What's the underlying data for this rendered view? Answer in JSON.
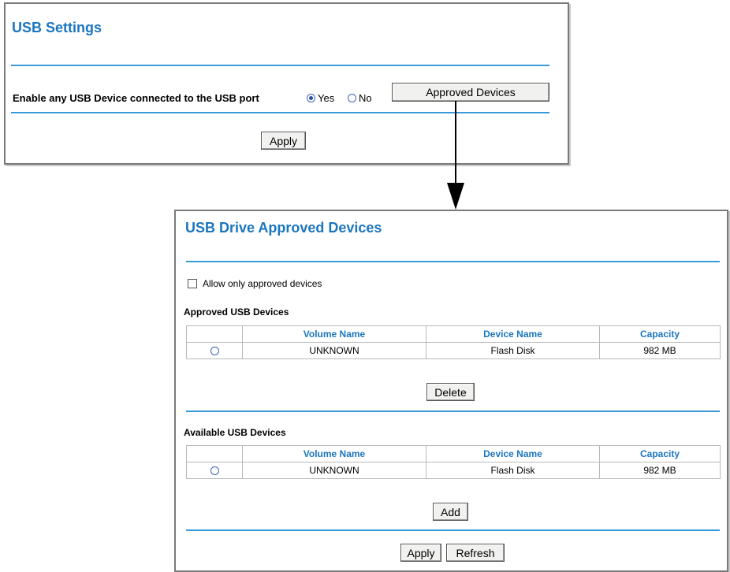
{
  "usb_settings": {
    "title": "USB Settings",
    "enable_label": "Enable any USB Device connected to the USB port",
    "yes_label": "Yes",
    "no_label": "No",
    "selected": "Yes",
    "approved_devices_button": "Approved Devices",
    "apply_button": "Apply"
  },
  "approved_devices": {
    "title": "USB Drive Approved Devices",
    "allow_only_label": "Allow only approved devices",
    "allow_only_checked": false,
    "approved_heading": "Approved USB Devices",
    "available_heading": "Available USB Devices",
    "columns": [
      "Volume Name",
      "Device Name",
      "Capacity"
    ],
    "approved_rows": [
      {
        "volume": "UNKNOWN",
        "device": "Flash Disk",
        "capacity": "982 MB"
      }
    ],
    "available_rows": [
      {
        "volume": "UNKNOWN",
        "device": "Flash Disk",
        "capacity": "982 MB"
      }
    ],
    "delete_button": "Delete",
    "add_button": "Add",
    "apply_button": "Apply",
    "refresh_button": "Refresh"
  },
  "colors": {
    "title": "#1b76bf",
    "rule": "#3a9ad9",
    "header_text": "#1b76bf"
  },
  "icons": {
    "connector": "down-arrow-icon"
  }
}
